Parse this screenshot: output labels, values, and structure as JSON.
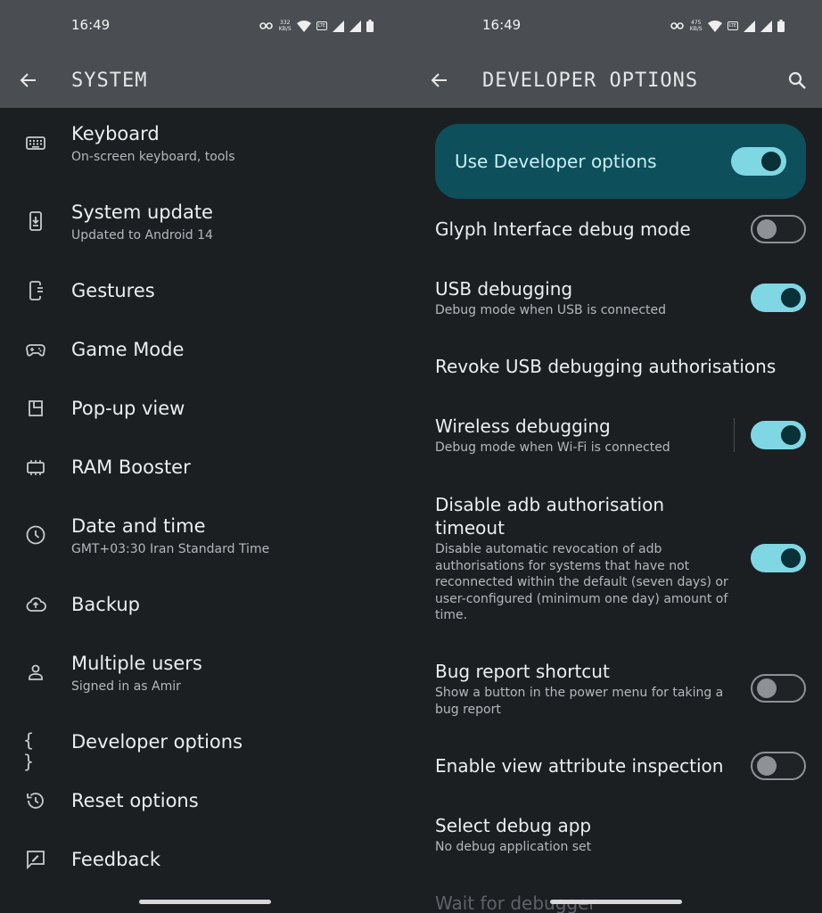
{
  "left": {
    "status": {
      "time": "16:49",
      "net_speed": "332",
      "net_unit": "KB/S",
      "lte": "LTE"
    },
    "title": "SYSTEM",
    "items": [
      {
        "title": "Keyboard",
        "subtitle": "On-screen keyboard, tools",
        "icon": "keyboard-icon"
      },
      {
        "title": "System update",
        "subtitle": "Updated to Android 14",
        "icon": "system-update-icon"
      },
      {
        "title": "Gestures",
        "icon": "gestures-icon"
      },
      {
        "title": "Game Mode",
        "icon": "gamepad-icon"
      },
      {
        "title": "Pop-up view",
        "icon": "popup-view-icon"
      },
      {
        "title": "RAM Booster",
        "icon": "ram-icon"
      },
      {
        "title": "Date and time",
        "subtitle": "GMT+03:30 Iran Standard Time",
        "icon": "clock-icon"
      },
      {
        "title": "Backup",
        "icon": "cloud-upload-icon"
      },
      {
        "title": "Multiple users",
        "subtitle": "Signed in as Amir",
        "icon": "person-icon"
      },
      {
        "title": "Developer options",
        "icon": "braces-icon",
        "glyph": "{ }"
      },
      {
        "title": "Reset options",
        "icon": "reset-history-icon"
      },
      {
        "title": "Feedback",
        "icon": "feedback-icon"
      }
    ]
  },
  "right": {
    "status": {
      "time": "16:49",
      "net_speed": "475",
      "net_unit": "KB/S",
      "lte": "LTE"
    },
    "title": "DEVELOPER OPTIONS",
    "master_toggle": {
      "label": "Use Developer options",
      "on": true
    },
    "items": [
      {
        "title": "Glyph Interface debug mode",
        "on": false
      },
      {
        "title": "USB debugging",
        "subtitle": "Debug mode when USB is connected",
        "on": true
      },
      {
        "title": "Revoke USB debugging authorisations"
      },
      {
        "title": "Wireless debugging",
        "subtitle": "Debug mode when Wi-Fi is connected",
        "on": true
      },
      {
        "title": "Disable adb authorisation timeout",
        "subtitle": "Disable automatic revocation of adb authorisations for systems that have not reconnected within the default (seven days) or user-configured (minimum one day) amount of time.",
        "on": true
      },
      {
        "title": "Bug report shortcut",
        "subtitle": "Show a button in the power menu for taking a bug report",
        "on": false
      },
      {
        "title": "Enable view attribute inspection",
        "on": false
      },
      {
        "title": "Select debug app",
        "subtitle": "No debug application set"
      },
      {
        "title": "Wait for debugger"
      }
    ]
  },
  "colors": {
    "surface": "#1b1f22",
    "appbar": "#4a4e52",
    "master_bg": "#0d4f5a",
    "toggle_on": "#7fd7e3",
    "toggle_off_border": "#8e9296"
  }
}
